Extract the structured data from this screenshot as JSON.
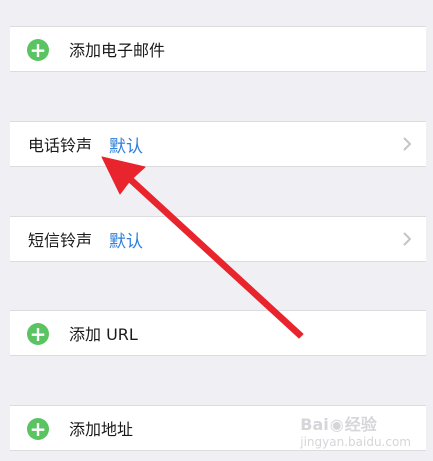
{
  "rows": {
    "add_email": {
      "label": "添加电子邮件",
      "icon": "plus-circle-icon"
    },
    "ringtone": {
      "label": "电话铃声",
      "value": "默认",
      "icon": "chevron-right-icon"
    },
    "text_tone": {
      "label": "短信铃声",
      "value": "默认",
      "icon": "chevron-right-icon"
    },
    "add_url": {
      "label": "添加 URL",
      "icon": "plus-circle-icon"
    },
    "add_address": {
      "label": "添加地址",
      "icon": "plus-circle-icon"
    }
  },
  "annotation": {
    "type": "arrow",
    "color": "#e8242c",
    "points_to": "电话铃声"
  },
  "watermark": {
    "logo_text": "Bai",
    "logo_text2": "经验",
    "sub": "jingyan.baidu.com"
  },
  "colors": {
    "background": "#efeff4",
    "row": "#ffffff",
    "accent_blue": "#2f7fdc",
    "plus_green": "#5ac462",
    "arrow_red": "#e8242c"
  }
}
